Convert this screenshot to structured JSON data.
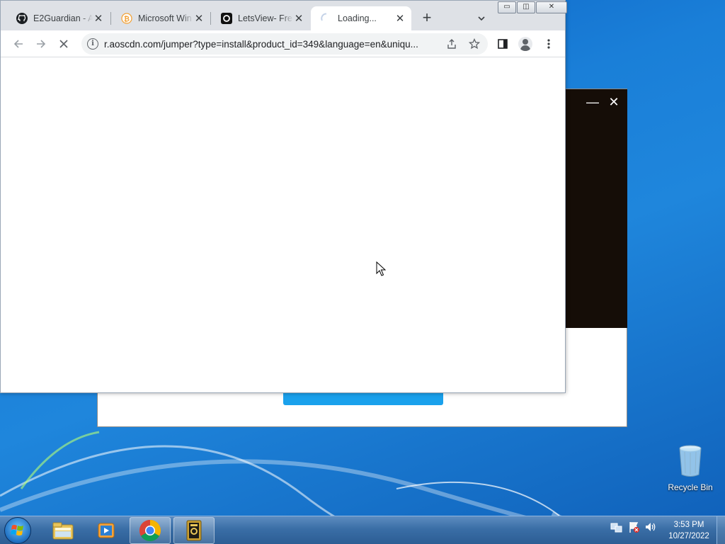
{
  "browser": {
    "tabs": [
      {
        "title": "E2Guardian - A",
        "favicon": "github-icon",
        "active": false
      },
      {
        "title": "Microsoft Win",
        "favicon": "bitcoin-icon",
        "active": false
      },
      {
        "title": "LetsView- Free",
        "favicon": "letsview-icon",
        "active": false
      },
      {
        "title": "Loading...",
        "favicon": "loading-spinner-icon",
        "active": true
      }
    ],
    "close_tab_glyph": "✕",
    "new_tab_glyph": "+",
    "address": {
      "url": "r.aoscdn.com/jumper?type=install&product_id=349&language=en&uniqu..."
    },
    "window_controls": {
      "minimize": "▭",
      "restore": "◫",
      "close": "✕"
    }
  },
  "installer": {
    "minimize": "—",
    "close": "✕"
  },
  "desktop": {
    "recycle_bin_label": "Recycle Bin"
  },
  "taskbar": {
    "clock_time": "3:53 PM",
    "clock_date": "10/27/2022",
    "items": [
      "file-explorer-icon",
      "media-player-icon",
      "chrome-icon",
      "installer-app-icon"
    ]
  },
  "colors": {
    "accent_blue": "#1aa1ec",
    "installer_dark": "#150d07"
  }
}
